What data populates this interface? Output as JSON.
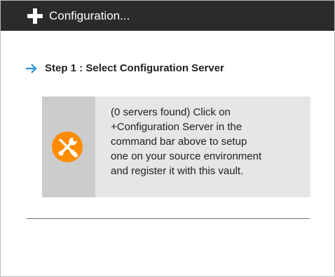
{
  "command_bar": {
    "action_label": "Configuration...",
    "action_icon": "plus-icon",
    "background": "#2b2b2b"
  },
  "step": {
    "title": "Step 1 : Select Configuration Server",
    "icon": "arrow-right-icon",
    "accent": "#2b8fd6"
  },
  "notice": {
    "icon": "tools-icon",
    "icon_color": "#ff8c00",
    "lines": [
      "(0 servers found) Click on",
      "+Configuration Server in the",
      "command bar above to setup",
      "one on your source environment",
      "and register it with this vault."
    ]
  }
}
